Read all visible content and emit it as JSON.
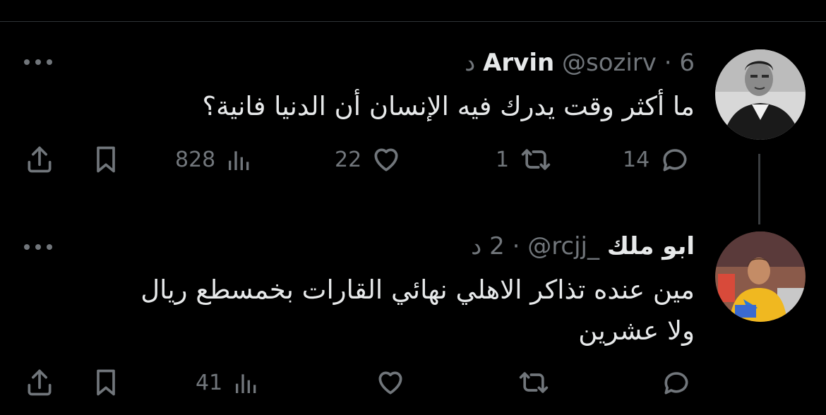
{
  "tweets": [
    {
      "display_name": "Arvin",
      "handle": "@sozirv",
      "separator": "·",
      "time": "6 د",
      "text": "ما أكثر وقت يدرك فيه الإنسان أن الدنيا فانية؟",
      "avatar": "profile-photo-man-in-suit",
      "stats": {
        "replies": "14",
        "retweets": "1",
        "likes": "22",
        "views": "828"
      }
    },
    {
      "display_name": "ابو ملك",
      "handle": "@rcjj_",
      "separator": "·",
      "time": "2 د",
      "text": "مين عنده تذاكر الاهلي نهائي القارات بخمسطع ريال ولا عشرين",
      "avatar": "profile-photo-footballer-yellow-shirt",
      "stats": {
        "replies": "",
        "retweets": "",
        "likes": "",
        "views": "41"
      }
    }
  ],
  "icons": {
    "reply": "reply-icon",
    "retweet": "retweet-icon",
    "like": "heart-icon",
    "views": "views-chart-icon",
    "bookmark": "bookmark-icon",
    "share": "share-icon",
    "more": "more-dots-icon"
  },
  "colors": {
    "background": "#000000",
    "text": "#e7e9ea",
    "muted": "#71767b"
  }
}
